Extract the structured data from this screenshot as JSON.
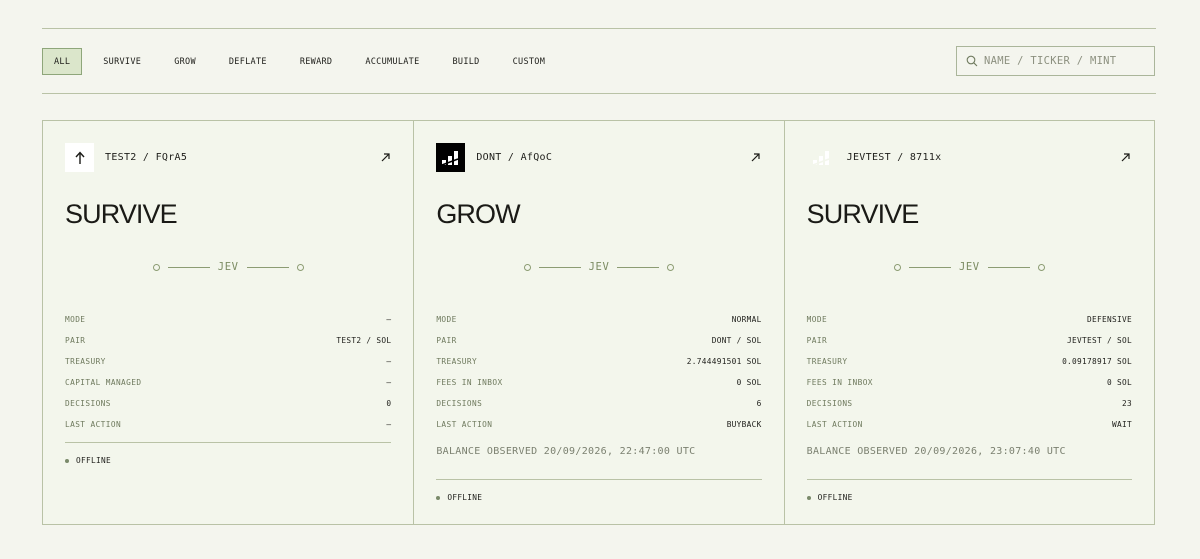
{
  "filters": [
    "ALL",
    "SURVIVE",
    "GROW",
    "DEFLATE",
    "REWARD",
    "ACCUMULATE",
    "BUILD",
    "CUSTOM"
  ],
  "active_filter": "ALL",
  "search": {
    "placeholder": "NAME / TICKER / MINT",
    "icon": "search-icon"
  },
  "divider_label": "JEV",
  "cards": [
    {
      "logo_icon": "arrow-up-icon",
      "logo_bg": "#ffffff",
      "ticker": "TEST2 / FQrA5",
      "strategy": "SURVIVE",
      "stats": [
        {
          "label": "MODE",
          "value": "—"
        },
        {
          "label": "PAIR",
          "value": "TEST2 / SOL"
        },
        {
          "label": "TREASURY",
          "value": "—"
        },
        {
          "label": "CAPITAL MANAGED",
          "value": "—"
        },
        {
          "label": "DECISIONS",
          "value": "0"
        },
        {
          "label": "LAST ACTION",
          "value": "—"
        }
      ],
      "observed": "",
      "status": "OFFLINE"
    },
    {
      "logo_icon": "bar-logo-icon",
      "logo_bg": "#000000",
      "ticker": "DONT / AfQoC",
      "strategy": "GROW",
      "stats": [
        {
          "label": "MODE",
          "value": "NORMAL"
        },
        {
          "label": "PAIR",
          "value": "DONT / SOL"
        },
        {
          "label": "TREASURY",
          "value": "2.744491501 SOL"
        },
        {
          "label": "FEES IN INBOX",
          "value": "0 SOL"
        },
        {
          "label": "DECISIONS",
          "value": "6"
        },
        {
          "label": "LAST ACTION",
          "value": "BUYBACK"
        }
      ],
      "observed": "BALANCE OBSERVED 20/09/2026, 22:47:00 UTC",
      "status": "OFFLINE"
    },
    {
      "logo_icon": "bar-logo-icon",
      "logo_bg": "#f3f6ec",
      "ticker": "JEVTEST / 8711x",
      "strategy": "SURVIVE",
      "stats": [
        {
          "label": "MODE",
          "value": "DEFENSIVE"
        },
        {
          "label": "PAIR",
          "value": "JEVTEST / SOL"
        },
        {
          "label": "TREASURY",
          "value": "0.09178917 SOL"
        },
        {
          "label": "FEES IN INBOX",
          "value": "0 SOL"
        },
        {
          "label": "DECISIONS",
          "value": "23"
        },
        {
          "label": "LAST ACTION",
          "value": "WAIT"
        }
      ],
      "observed": "BALANCE OBSERVED 20/09/2026, 23:07:40 UTC",
      "status": "OFFLINE"
    }
  ],
  "colors": {
    "accent_bg": "#dbe6cb",
    "accent_border": "#8ea67a",
    "rule": "#b9c2a6",
    "page_bg": "#f4f5ee"
  }
}
